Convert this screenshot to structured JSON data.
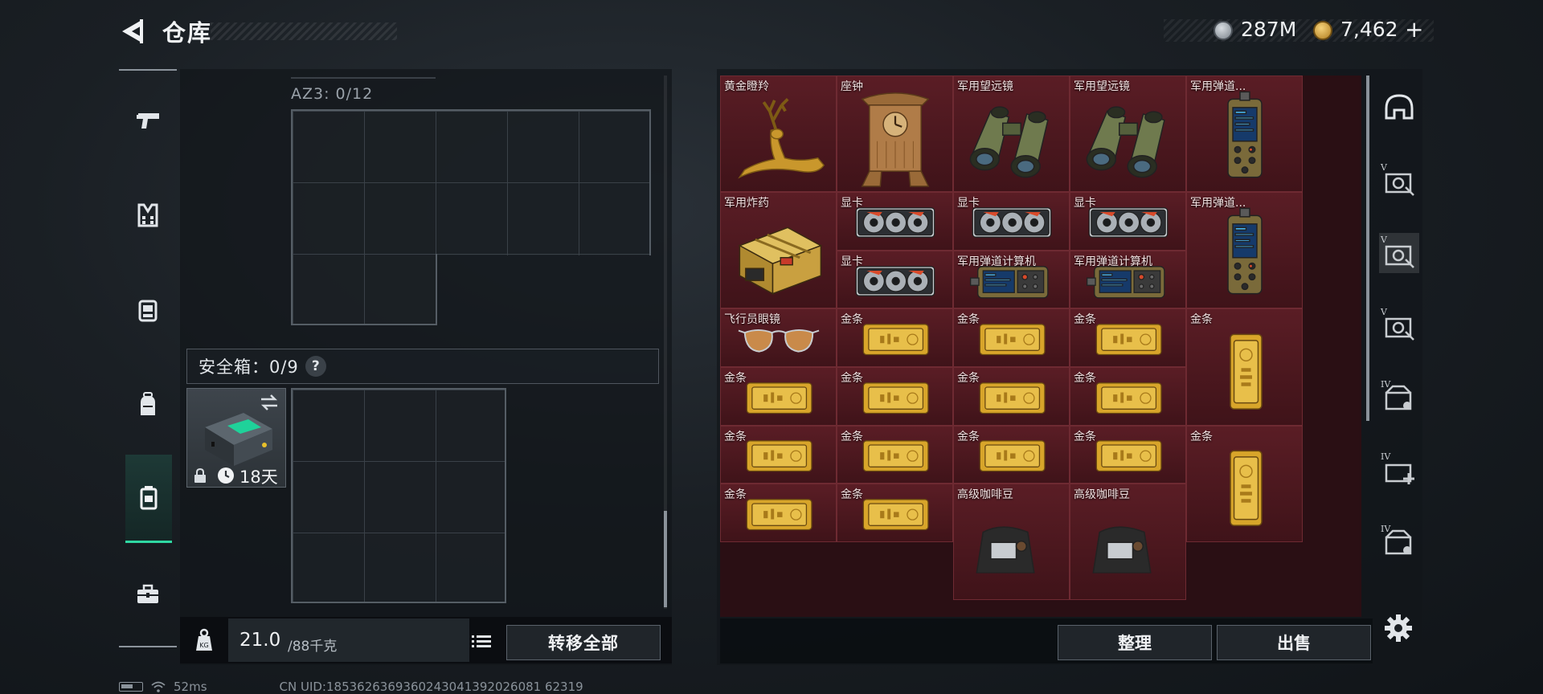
{
  "header": {
    "title": "仓库",
    "currency": [
      {
        "icon": "coin-icon",
        "value": "287M"
      },
      {
        "icon": "gold-coin-icon",
        "value": "7,462"
      }
    ],
    "plus_label": "+"
  },
  "left_nav": {
    "items": [
      {
        "name": "weapons",
        "icon": "pistol-icon",
        "active": false
      },
      {
        "name": "armor",
        "icon": "vest-icon",
        "active": false
      },
      {
        "name": "chest-rig",
        "icon": "rig-icon",
        "active": false
      },
      {
        "name": "backpack",
        "icon": "backpack-icon",
        "active": false
      },
      {
        "name": "safe-box",
        "icon": "safe-box-icon",
        "active": true
      },
      {
        "name": "toolbox",
        "icon": "toolbox-icon",
        "active": false
      }
    ]
  },
  "left_panel": {
    "az3_label": "AZ3: 0/12",
    "safe_box_label": "安全箱：0/9",
    "help_label": "?",
    "case_days": "18天",
    "weight_value": "21.0",
    "weight_max": "/88千克",
    "move_all_label": "转移全部"
  },
  "stash": {
    "cells": [
      {
        "label": "黄金瞪羚",
        "item": "golden-gazelle",
        "rarity_color": "#5a1d25"
      },
      {
        "label": "座钟",
        "item": "mantel-clock",
        "rarity_color": "#5a1d25"
      },
      {
        "label": "军用望远镜",
        "item": "binoculars",
        "rarity_color": "#5a1d25"
      },
      {
        "label": "军用望远镜",
        "item": "binoculars",
        "rarity_color": "#5a1d25"
      },
      {
        "label": "军用弹道...",
        "item": "ballistic-computer-tall",
        "rarity_color": "#5a1d25"
      },
      {
        "label": "军用炸药",
        "item": "explosives-crate",
        "rarity_color": "#5a1d25"
      },
      {
        "label": "显卡",
        "item": "graphics-card",
        "rarity_color": "#5a1d25"
      },
      {
        "label": "显卡",
        "item": "graphics-card",
        "rarity_color": "#5a1d25"
      },
      {
        "label": "显卡",
        "item": "graphics-card",
        "rarity_color": "#5a1d25"
      },
      {
        "label": "军用弹道...",
        "item": "ballistic-computer-tall",
        "rarity_color": "#5a1d25"
      },
      {
        "label": "显卡",
        "item": "graphics-card",
        "rarity_color": "#5a1d25"
      },
      {
        "label": "军用弹道计算机",
        "item": "ballistic-computer",
        "rarity_color": "#5a1d25"
      },
      {
        "label": "军用弹道计算机",
        "item": "ballistic-computer",
        "rarity_color": "#5a1d25"
      },
      {
        "label": "飞行员眼镜",
        "item": "aviator-glasses",
        "rarity_color": "#5a1d25"
      },
      {
        "label": "金条",
        "item": "gold-bar",
        "rarity_color": "#5a1d25"
      },
      {
        "label": "金条",
        "item": "gold-bar",
        "rarity_color": "#5a1d25"
      },
      {
        "label": "金条",
        "item": "gold-bar",
        "rarity_color": "#5a1d25"
      },
      {
        "label": "金条",
        "item": "gold-bar-vertical",
        "rarity_color": "#5a1d25"
      },
      {
        "label": "金条",
        "item": "gold-bar",
        "rarity_color": "#5a1d25"
      },
      {
        "label": "金条",
        "item": "gold-bar",
        "rarity_color": "#5a1d25"
      },
      {
        "label": "金条",
        "item": "gold-bar",
        "rarity_color": "#5a1d25"
      },
      {
        "label": "金条",
        "item": "gold-bar",
        "rarity_color": "#5a1d25"
      },
      {
        "label": "金条",
        "item": "gold-bar",
        "rarity_color": "#5a1d25"
      },
      {
        "label": "金条",
        "item": "gold-bar",
        "rarity_color": "#5a1d25"
      },
      {
        "label": "金条",
        "item": "gold-bar",
        "rarity_color": "#5a1d25"
      },
      {
        "label": "金条",
        "item": "gold-bar",
        "rarity_color": "#5a1d25"
      },
      {
        "label": "金条",
        "item": "gold-bar-vertical",
        "rarity_color": "#5a1d25"
      },
      {
        "label": "金条",
        "item": "gold-bar",
        "rarity_color": "#5a1d25"
      },
      {
        "label": "金条",
        "item": "gold-bar",
        "rarity_color": "#5a1d25"
      },
      {
        "label": "高级咖啡豆",
        "item": "coffee-beans",
        "rarity_color": "#5a1d25"
      },
      {
        "label": "高级咖啡豆",
        "item": "coffee-beans",
        "rarity_color": "#5a1d25"
      }
    ],
    "sort_label": "整理",
    "sell_label": "出售"
  },
  "right_nav": {
    "items": [
      {
        "name": "stash-all",
        "icon": "helmet-icon"
      },
      {
        "name": "stash-v-1",
        "icon": "stash-tab-v-icon",
        "tier": "V"
      },
      {
        "name": "stash-v-2",
        "icon": "stash-tab-v-icon",
        "tier": "V",
        "active": true
      },
      {
        "name": "stash-v-3",
        "icon": "stash-tab-v-icon",
        "tier": "V"
      },
      {
        "name": "stash-iv-1",
        "icon": "stash-tab-iv-icon",
        "tier": "IV"
      },
      {
        "name": "stash-iv-add",
        "icon": "stash-tab-add-icon",
        "tier": "IV"
      },
      {
        "name": "stash-iv-2",
        "icon": "stash-tab-iv-icon",
        "tier": "IV"
      }
    ]
  },
  "status_bar": {
    "ping": "52ms",
    "uid": "CN UID:1853626369360243041392026081 62319"
  },
  "colors": {
    "accent": "#2fd8a2",
    "cell_red": "#5a1d25",
    "gold": "#d8a52a"
  }
}
